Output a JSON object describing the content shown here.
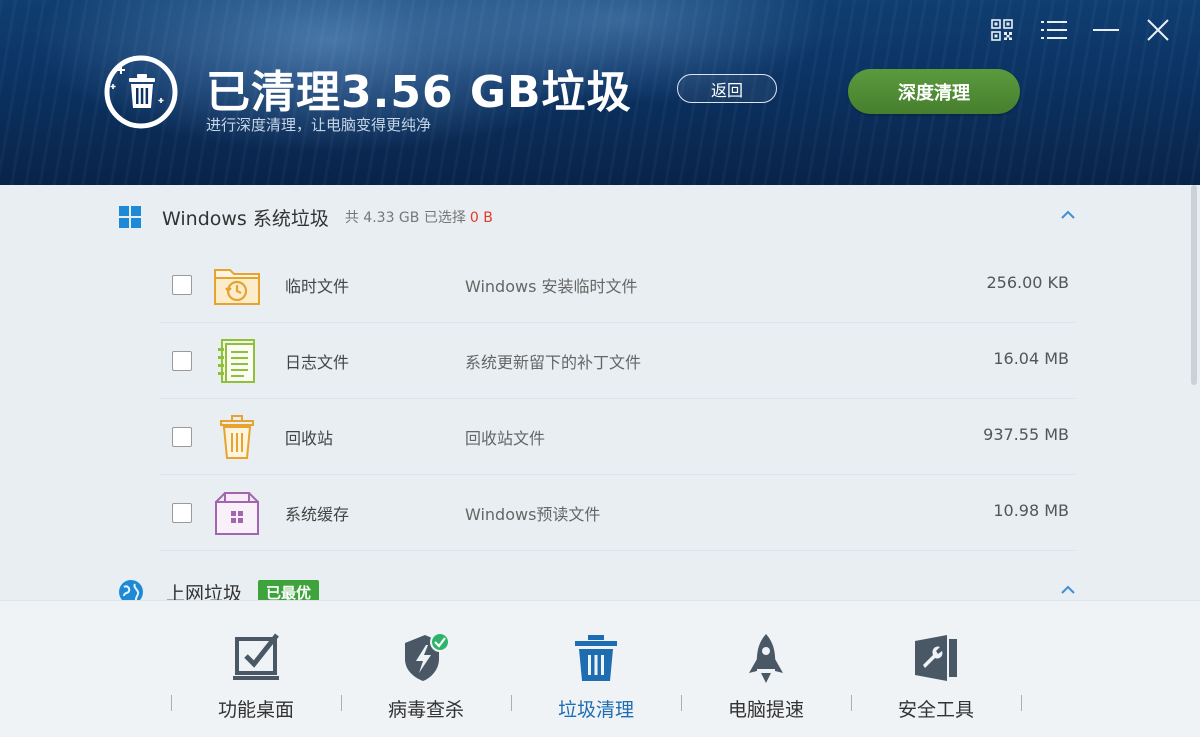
{
  "header": {
    "title": "已清理3.56 GB垃圾",
    "subtitle": "进行深度清理，让电脑变得更纯净",
    "back_label": "返回",
    "deep_clean_label": "深度清理"
  },
  "window_controls": {
    "icons": [
      "qrcode-icon",
      "menu-icon",
      "minimize-icon",
      "close-icon"
    ]
  },
  "windows_section": {
    "title": "Windows 系统垃圾",
    "stats_prefix": "共 4.33 GB 已选择",
    "selected": "0 B",
    "rows": [
      {
        "name": "临时文件",
        "desc": "Windows 安装临时文件",
        "size": "256.00 KB",
        "icon": "temp-folder-icon"
      },
      {
        "name": "日志文件",
        "desc": "系统更新留下的补丁文件",
        "size": "16.04 MB",
        "icon": "log-file-icon"
      },
      {
        "name": "回收站",
        "desc": "回收站文件",
        "size": "937.55 MB",
        "icon": "recycle-bin-icon"
      },
      {
        "name": "系统缓存",
        "desc": "Windows预读文件",
        "size": "10.98 MB",
        "icon": "system-cache-icon"
      }
    ]
  },
  "internet_section": {
    "title": "上网垃圾",
    "badge": "已最优"
  },
  "nav": {
    "items": [
      {
        "label": "功能桌面",
        "icon": "desktop-check-icon"
      },
      {
        "label": "病毒查杀",
        "icon": "shield-icon"
      },
      {
        "label": "垃圾清理",
        "icon": "trash-icon",
        "active": true
      },
      {
        "label": "电脑提速",
        "icon": "rocket-icon"
      },
      {
        "label": "安全工具",
        "icon": "toolbox-icon"
      }
    ]
  },
  "colors": {
    "accent_green": "#4f8c35",
    "selected_red": "#e23b2a",
    "active_blue": "#1e6db3",
    "badge_green": "#3ea33a"
  }
}
